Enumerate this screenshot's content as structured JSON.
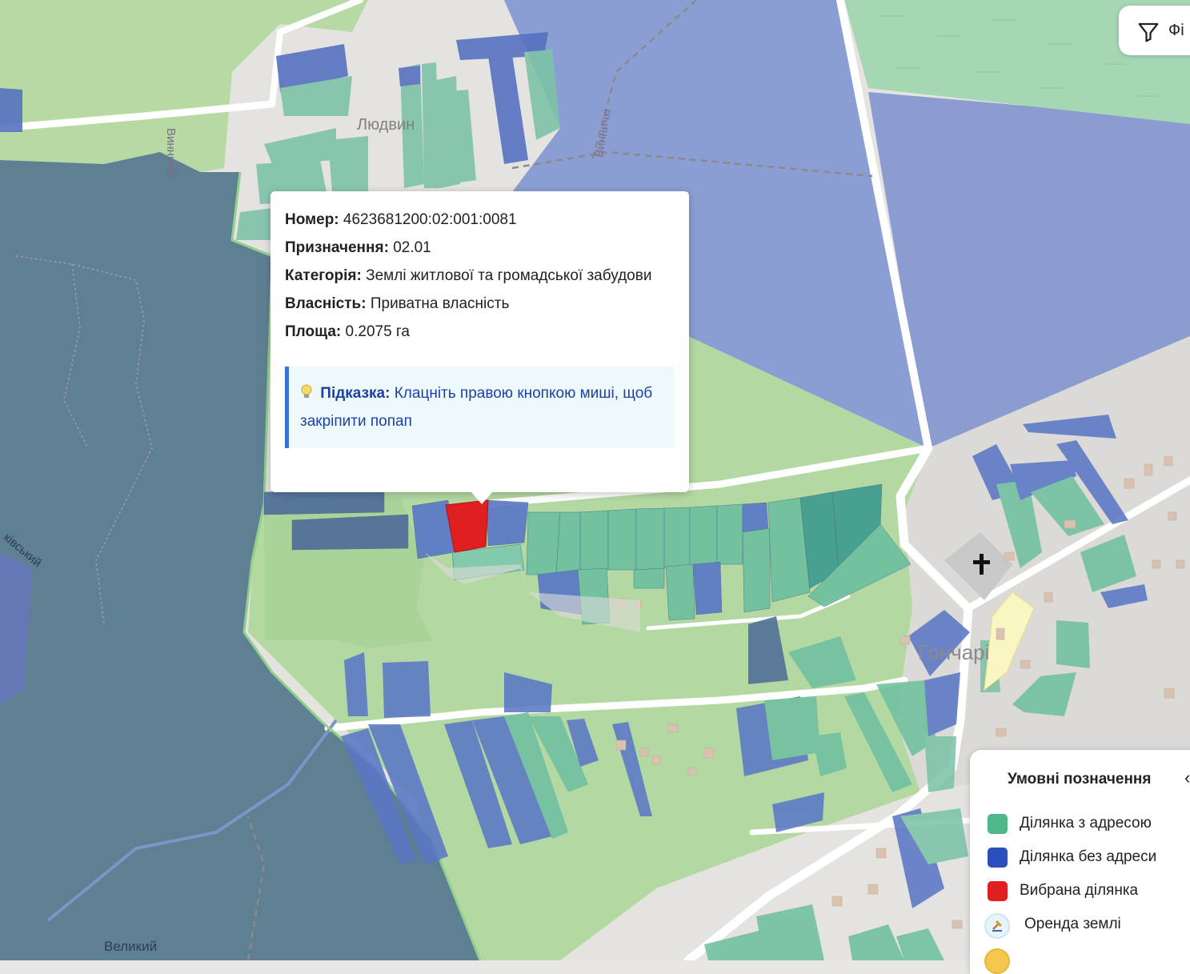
{
  "map": {
    "place_labels": [
      "Людвин",
      "Винничкі",
      "Винничкі",
      "Гончарі",
      "Великий",
      "ківський"
    ],
    "colors": {
      "parcel_with_address": "#4fb88b",
      "parcel_without_address": "#2b4fbd",
      "selected_parcel": "#e02020",
      "forest": "#5e7e93",
      "meadow": "#b8dca3",
      "road": "#ffffff"
    }
  },
  "filter_button": {
    "label": "Фі",
    "icon": "filter-icon"
  },
  "popup": {
    "number_label": "Номер:",
    "number_value": "4623681200:02:001:0081",
    "purpose_label": "Призначення:",
    "purpose_value": "02.01",
    "category_label": "Категорія:",
    "category_value": "Землі житлової та громадської забудови",
    "ownership_label": "Власність:",
    "ownership_value": "Приватна власність",
    "area_label": "Площа:",
    "area_value": "0.2075 га",
    "hint_label": "Підказка:",
    "hint_text": "Клацніть правою кнопкою миші, щоб закріпити попап",
    "hint_icon": "lightbulb-icon"
  },
  "legend": {
    "title": "Умовні позначення",
    "toggle_icon": "chevron-left-icon",
    "items": [
      {
        "label": "Ділянка з адресою",
        "color": "#4fb88b"
      },
      {
        "label": "Ділянка без адреси",
        "color": "#2b4fbd"
      },
      {
        "label": "Вибрана ділянка",
        "color": "#e02020"
      },
      {
        "label": "Оренда землі",
        "icon": "land-lease-icon"
      }
    ]
  }
}
